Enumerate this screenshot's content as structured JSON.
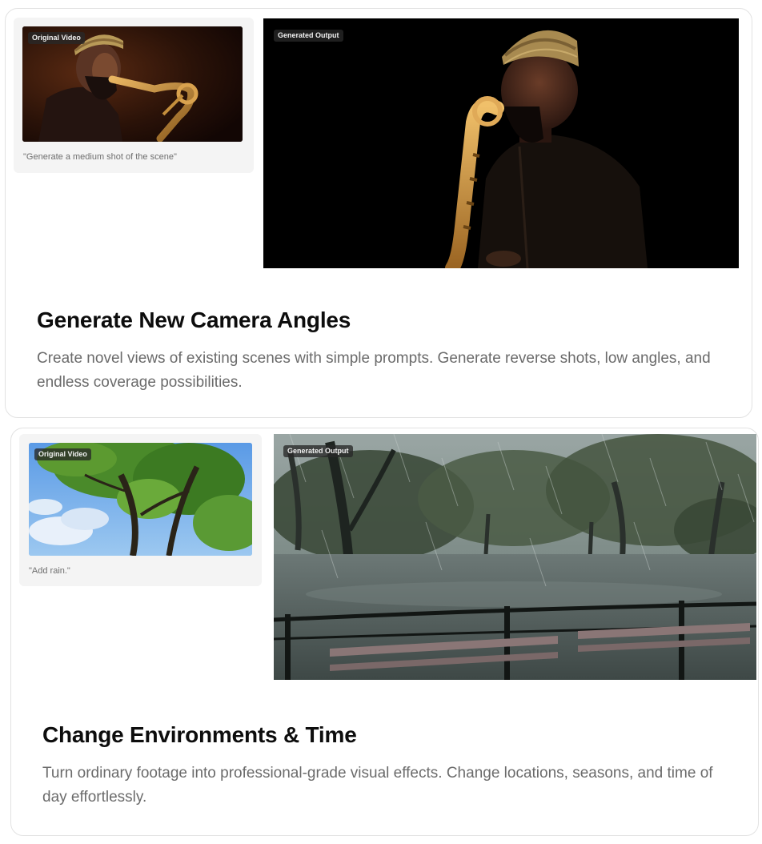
{
  "features": [
    {
      "original_badge": "Original Video",
      "prompt": "\"Generate a medium shot of the scene\"",
      "generated_badge": "Generated Output",
      "title": "Generate New Camera Angles",
      "description": "Create novel views of existing scenes with simple prompts. Generate reverse shots, low angles, and endless coverage possibilities."
    },
    {
      "original_badge": "Original Video",
      "prompt": "\"Add rain.\"",
      "generated_badge": "Generated Output",
      "title": "Change Environments & Time",
      "description": "Turn ordinary footage into professional-grade visual effects. Change locations, seasons, and time of day effortlessly."
    }
  ]
}
